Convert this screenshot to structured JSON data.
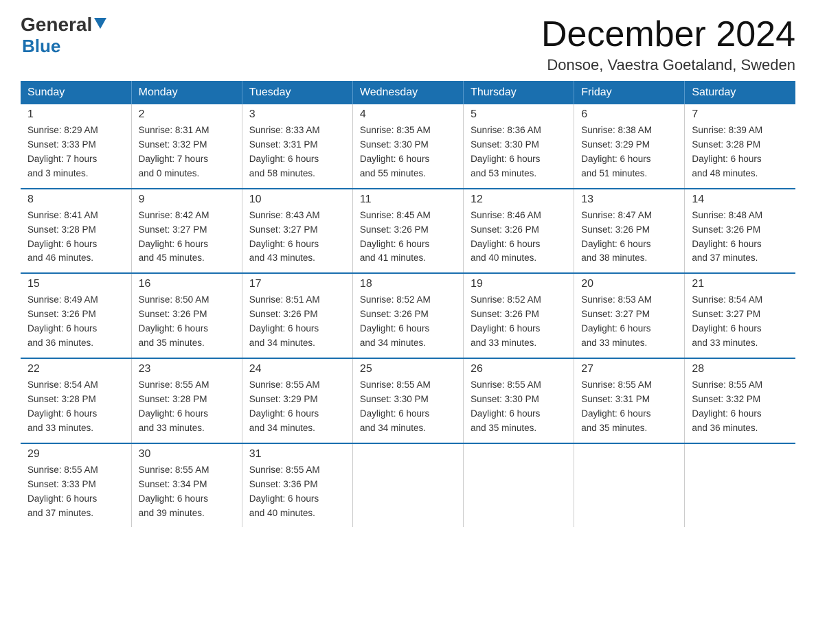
{
  "logo": {
    "general": "General",
    "blue": "Blue"
  },
  "header": {
    "title": "December 2024",
    "subtitle": "Donsoe, Vaestra Goetaland, Sweden"
  },
  "weekdays": [
    "Sunday",
    "Monday",
    "Tuesday",
    "Wednesday",
    "Thursday",
    "Friday",
    "Saturday"
  ],
  "weeks": [
    [
      {
        "day": "1",
        "sunrise": "8:29 AM",
        "sunset": "3:33 PM",
        "daylight": "7 hours and 3 minutes."
      },
      {
        "day": "2",
        "sunrise": "8:31 AM",
        "sunset": "3:32 PM",
        "daylight": "7 hours and 0 minutes."
      },
      {
        "day": "3",
        "sunrise": "8:33 AM",
        "sunset": "3:31 PM",
        "daylight": "6 hours and 58 minutes."
      },
      {
        "day": "4",
        "sunrise": "8:35 AM",
        "sunset": "3:30 PM",
        "daylight": "6 hours and 55 minutes."
      },
      {
        "day": "5",
        "sunrise": "8:36 AM",
        "sunset": "3:30 PM",
        "daylight": "6 hours and 53 minutes."
      },
      {
        "day": "6",
        "sunrise": "8:38 AM",
        "sunset": "3:29 PM",
        "daylight": "6 hours and 51 minutes."
      },
      {
        "day": "7",
        "sunrise": "8:39 AM",
        "sunset": "3:28 PM",
        "daylight": "6 hours and 48 minutes."
      }
    ],
    [
      {
        "day": "8",
        "sunrise": "8:41 AM",
        "sunset": "3:28 PM",
        "daylight": "6 hours and 46 minutes."
      },
      {
        "day": "9",
        "sunrise": "8:42 AM",
        "sunset": "3:27 PM",
        "daylight": "6 hours and 45 minutes."
      },
      {
        "day": "10",
        "sunrise": "8:43 AM",
        "sunset": "3:27 PM",
        "daylight": "6 hours and 43 minutes."
      },
      {
        "day": "11",
        "sunrise": "8:45 AM",
        "sunset": "3:26 PM",
        "daylight": "6 hours and 41 minutes."
      },
      {
        "day": "12",
        "sunrise": "8:46 AM",
        "sunset": "3:26 PM",
        "daylight": "6 hours and 40 minutes."
      },
      {
        "day": "13",
        "sunrise": "8:47 AM",
        "sunset": "3:26 PM",
        "daylight": "6 hours and 38 minutes."
      },
      {
        "day": "14",
        "sunrise": "8:48 AM",
        "sunset": "3:26 PM",
        "daylight": "6 hours and 37 minutes."
      }
    ],
    [
      {
        "day": "15",
        "sunrise": "8:49 AM",
        "sunset": "3:26 PM",
        "daylight": "6 hours and 36 minutes."
      },
      {
        "day": "16",
        "sunrise": "8:50 AM",
        "sunset": "3:26 PM",
        "daylight": "6 hours and 35 minutes."
      },
      {
        "day": "17",
        "sunrise": "8:51 AM",
        "sunset": "3:26 PM",
        "daylight": "6 hours and 34 minutes."
      },
      {
        "day": "18",
        "sunrise": "8:52 AM",
        "sunset": "3:26 PM",
        "daylight": "6 hours and 34 minutes."
      },
      {
        "day": "19",
        "sunrise": "8:52 AM",
        "sunset": "3:26 PM",
        "daylight": "6 hours and 33 minutes."
      },
      {
        "day": "20",
        "sunrise": "8:53 AM",
        "sunset": "3:27 PM",
        "daylight": "6 hours and 33 minutes."
      },
      {
        "day": "21",
        "sunrise": "8:54 AM",
        "sunset": "3:27 PM",
        "daylight": "6 hours and 33 minutes."
      }
    ],
    [
      {
        "day": "22",
        "sunrise": "8:54 AM",
        "sunset": "3:28 PM",
        "daylight": "6 hours and 33 minutes."
      },
      {
        "day": "23",
        "sunrise": "8:55 AM",
        "sunset": "3:28 PM",
        "daylight": "6 hours and 33 minutes."
      },
      {
        "day": "24",
        "sunrise": "8:55 AM",
        "sunset": "3:29 PM",
        "daylight": "6 hours and 34 minutes."
      },
      {
        "day": "25",
        "sunrise": "8:55 AM",
        "sunset": "3:30 PM",
        "daylight": "6 hours and 34 minutes."
      },
      {
        "day": "26",
        "sunrise": "8:55 AM",
        "sunset": "3:30 PM",
        "daylight": "6 hours and 35 minutes."
      },
      {
        "day": "27",
        "sunrise": "8:55 AM",
        "sunset": "3:31 PM",
        "daylight": "6 hours and 35 minutes."
      },
      {
        "day": "28",
        "sunrise": "8:55 AM",
        "sunset": "3:32 PM",
        "daylight": "6 hours and 36 minutes."
      }
    ],
    [
      {
        "day": "29",
        "sunrise": "8:55 AM",
        "sunset": "3:33 PM",
        "daylight": "6 hours and 37 minutes."
      },
      {
        "day": "30",
        "sunrise": "8:55 AM",
        "sunset": "3:34 PM",
        "daylight": "6 hours and 39 minutes."
      },
      {
        "day": "31",
        "sunrise": "8:55 AM",
        "sunset": "3:36 PM",
        "daylight": "6 hours and 40 minutes."
      },
      null,
      null,
      null,
      null
    ]
  ],
  "labels": {
    "sunrise": "Sunrise:",
    "sunset": "Sunset:",
    "daylight": "Daylight:"
  }
}
